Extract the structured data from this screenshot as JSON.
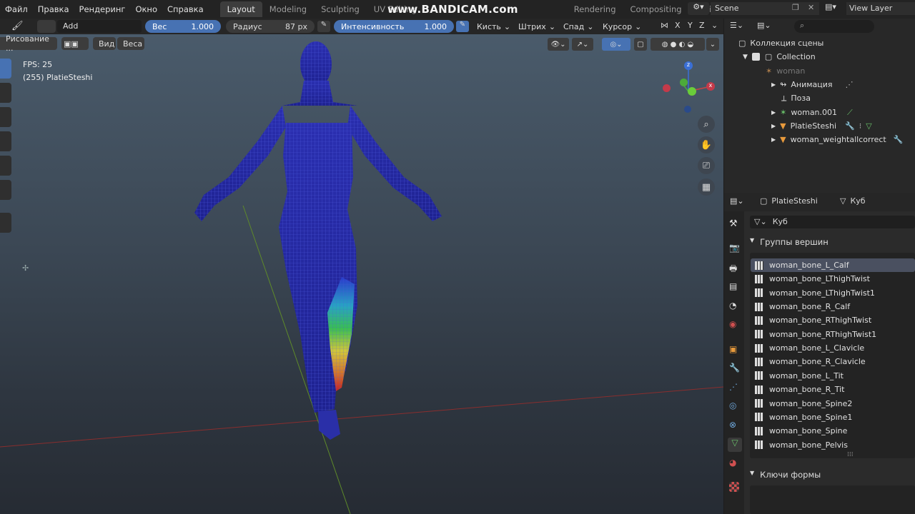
{
  "menu": [
    "Файл",
    "Правка",
    "Рендеринг",
    "Окно",
    "Справка"
  ],
  "workspaces": [
    {
      "label": "Layout",
      "active": true
    },
    {
      "label": "Modeling",
      "active": false
    },
    {
      "label": "Sculpting",
      "active": false
    },
    {
      "label": "UV Editing",
      "active": false
    },
    {
      "label": "Rendering",
      "active": false
    },
    {
      "label": "Compositing",
      "active": false
    },
    {
      "label": "Scriptin",
      "active": false
    }
  ],
  "watermark": "www.BANDICAM.com",
  "scene": {
    "name": "Scene",
    "view_layer": "View Layer"
  },
  "tool_header": {
    "blend_mode": "Add",
    "weight_label": "Вес",
    "weight_value": "1.000",
    "radius_label": "Радиус",
    "radius_value": "87 px",
    "strength_label": "Интенсивность",
    "strength_value": "1.000",
    "brush": "Кисть",
    "stroke": "Штрих",
    "falloff": "Спад",
    "cursor": "Курсор",
    "axes": [
      "X",
      "Y",
      "Z"
    ]
  },
  "viewport_header": {
    "mode": "Рисование ...",
    "view": "Вид",
    "weights": "Веса"
  },
  "viewport_overlay": {
    "fps": "FPS: 25",
    "object_info": "(255) PlatieSteshi"
  },
  "outliner": {
    "header": "Коллекция сцены",
    "collection": "Collection",
    "items": [
      {
        "label": "woman",
        "dim": true
      },
      {
        "label": "Анимация"
      },
      {
        "label": "Поза"
      },
      {
        "label": "woman.001"
      },
      {
        "label": "PlatieSteshi"
      },
      {
        "label": "woman_weightallcorrect"
      }
    ]
  },
  "properties": {
    "object": "PlatieSteshi",
    "mesh": "Куб",
    "mesh_field": "Куб",
    "vertex_groups_title": "Группы вершин",
    "vertex_groups": [
      "woman_bone_L_Calf",
      "woman_bone_LThighTwist",
      "woman_bone_LThighTwist1",
      "woman_bone_R_Calf",
      "woman_bone_RThighTwist",
      "woman_bone_RThighTwist1",
      "woman_bone_L_Clavicle",
      "woman_bone_R_Clavicle",
      "woman_bone_L_Tit",
      "woman_bone_R_Tit",
      "woman_bone_Spine2",
      "woman_bone_Spine1",
      "woman_bone_Spine",
      "woman_bone_Pelvis"
    ],
    "shape_keys_title": "Ключи формы"
  },
  "colors": {
    "accent": "#4772b3",
    "selected_row": "#4a5060",
    "orange_icon": "#e89a3c"
  }
}
